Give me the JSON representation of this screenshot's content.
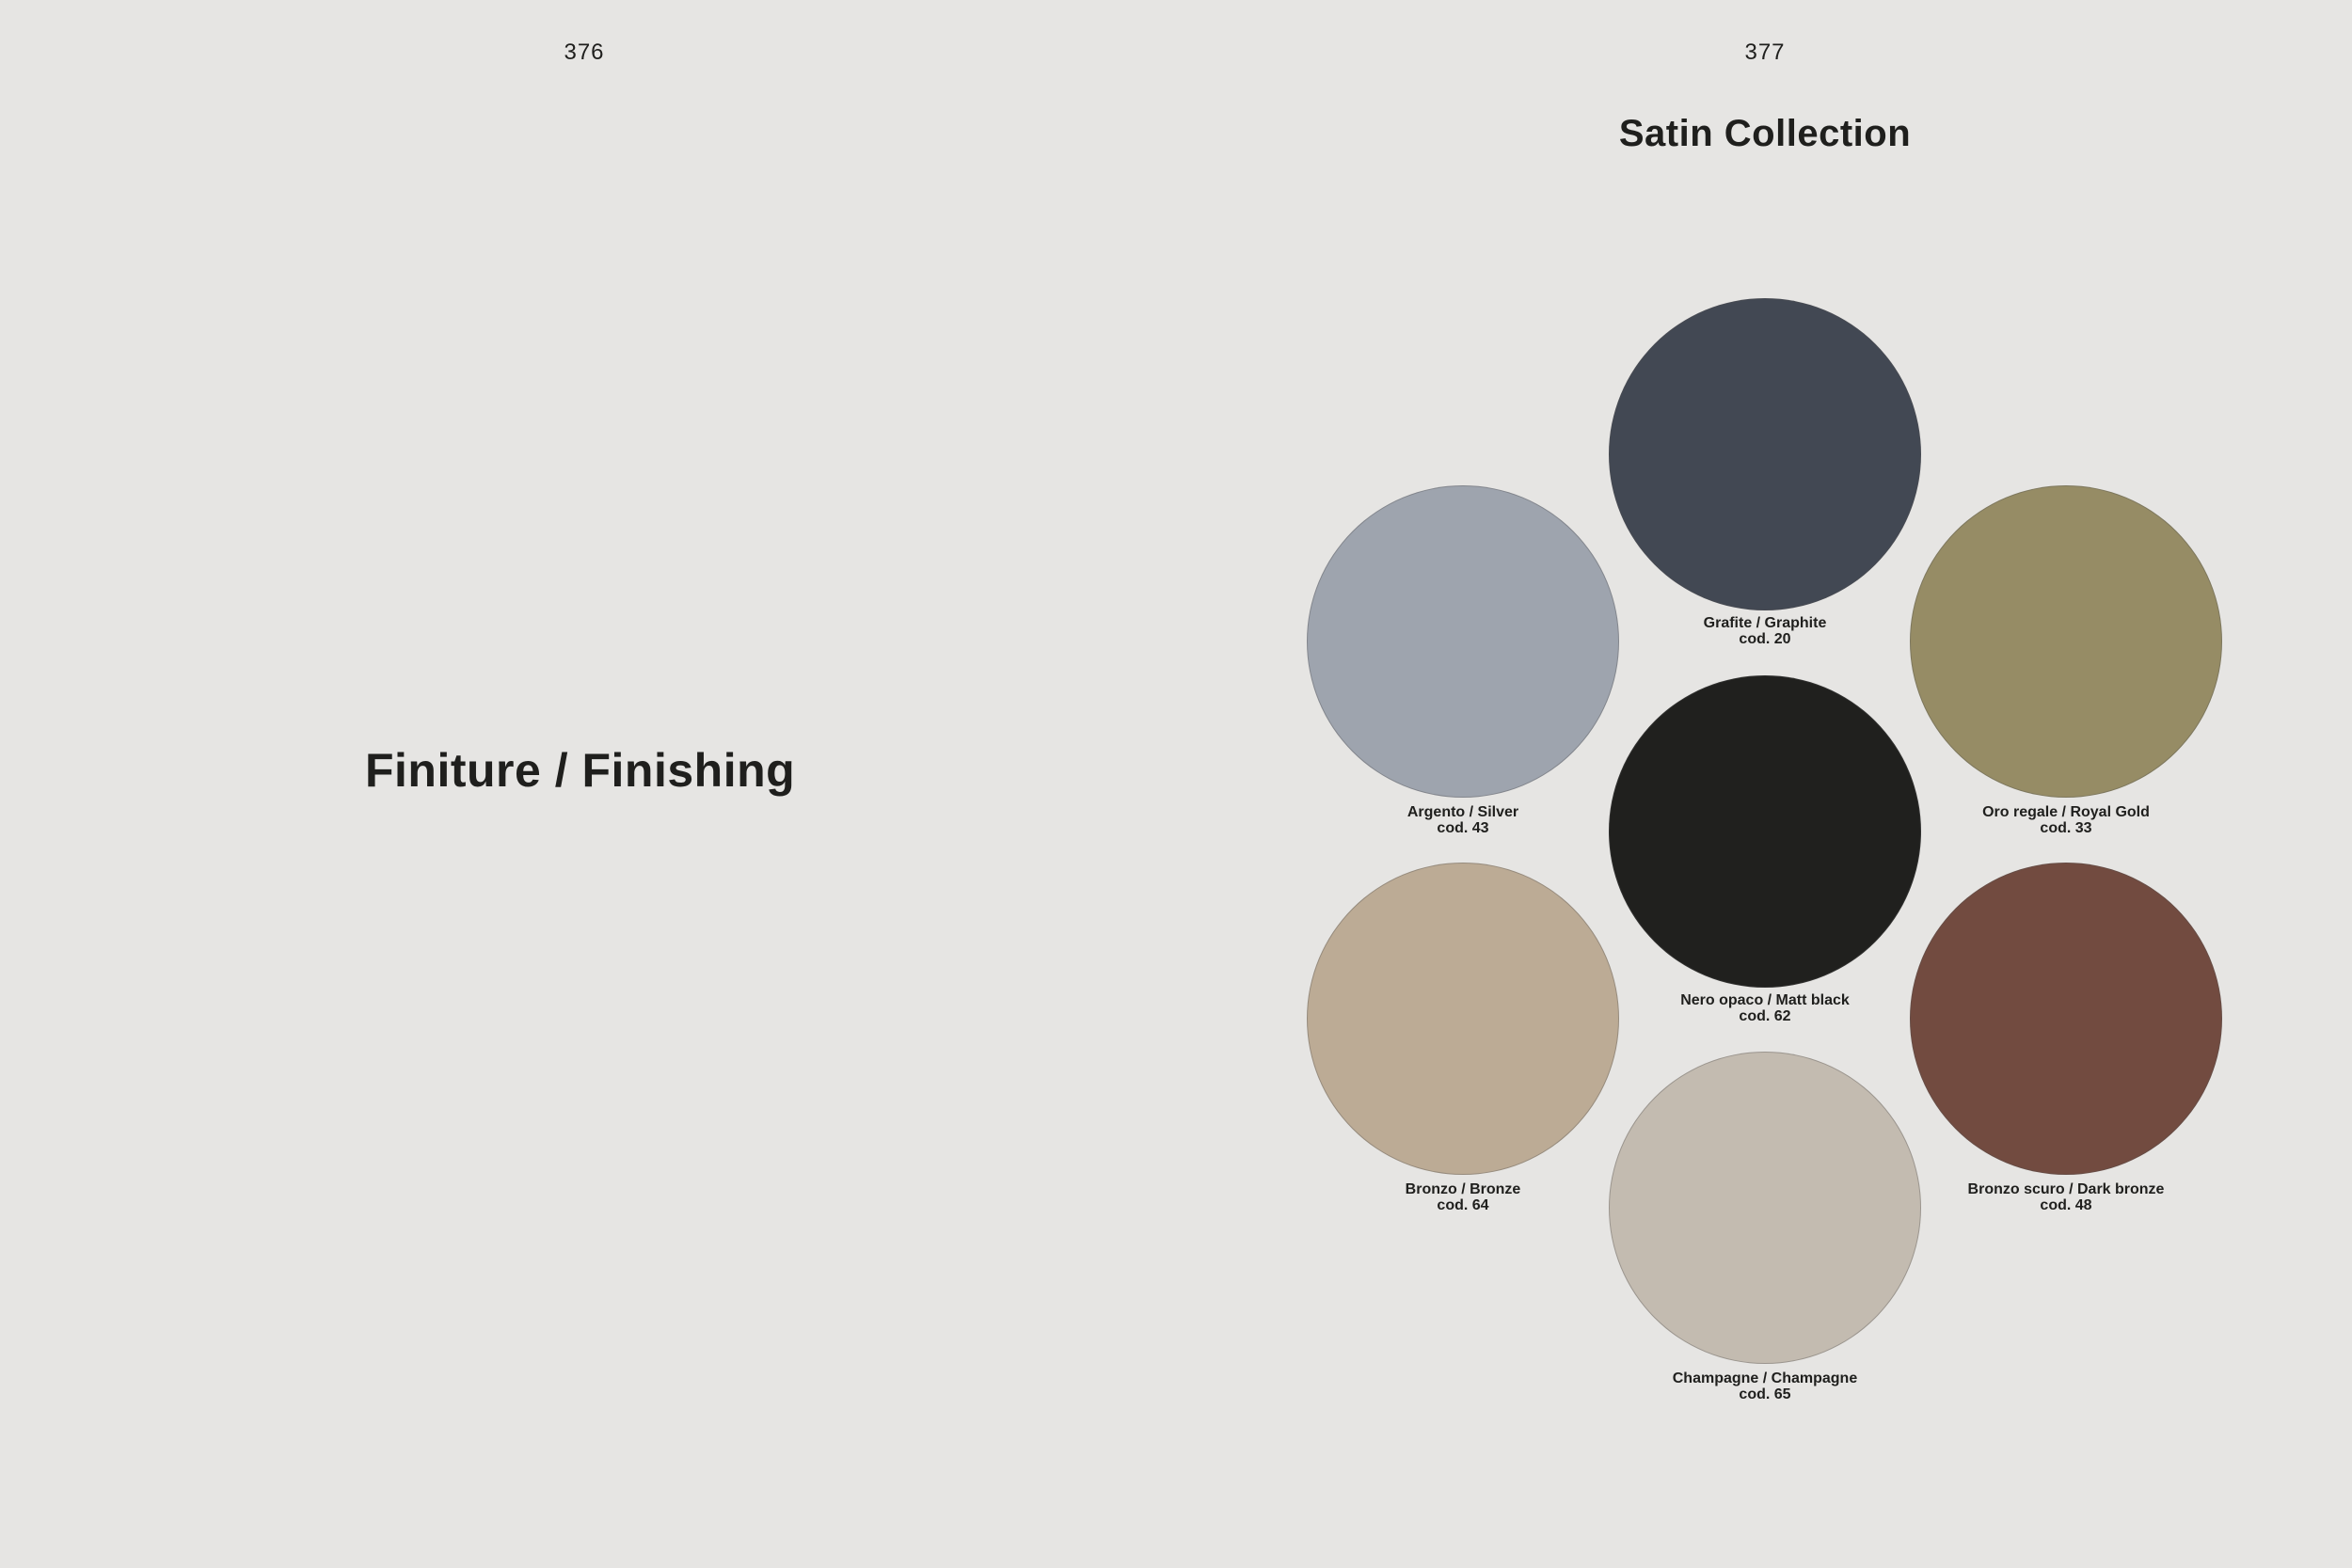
{
  "left_page": {
    "page_number": "376",
    "title": "Finiture / Finishing"
  },
  "right_page": {
    "page_number": "377",
    "title": "Satin Collection"
  },
  "swatches": {
    "graphite": {
      "name": "Grafite / Graphite",
      "code": "cod. 20",
      "color": "#424853"
    },
    "silver": {
      "name": "Argento / Silver",
      "code": "cod. 43",
      "color": "#9ea4ae"
    },
    "royal_gold": {
      "name": "Oro regale / Royal Gold",
      "code": "cod. 33",
      "color": "#968c65"
    },
    "matt_black": {
      "name": "Nero opaco / Matt black",
      "code": "cod. 62",
      "color": "#20201e"
    },
    "bronze": {
      "name": "Bronzo / Bronze",
      "code": "cod. 64",
      "color": "#bcab95"
    },
    "dark_bronze": {
      "name": "Bronzo scuro / Dark bronze",
      "code": "cod. 48",
      "color": "#724b40"
    },
    "champagne": {
      "name": "Champagne / Champagne",
      "code": "cod. 65",
      "color": "#c3bbb0"
    }
  }
}
